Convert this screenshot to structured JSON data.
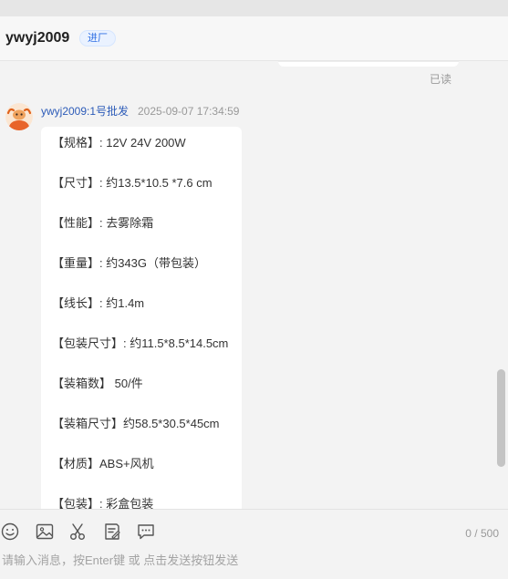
{
  "header": {
    "title": "ywyj2009",
    "badge": "进厂"
  },
  "chat": {
    "read_status": "已读",
    "message": {
      "sender": "ywyj2009:1号批发",
      "timestamp": "2025-09-07 17:34:59",
      "lines": [
        "【规格】: 12V 24V 200W",
        "【尺寸】: 约13.5*10.5 *7.6 cm",
        "【性能】: 去雾除霜",
        "【重量】: 约343G（带包装）",
        "【线长】: 约1.4m",
        "【包装尺寸】: 约11.5*8.5*14.5cm",
        "【装箱数】 50/件",
        "【装箱尺寸】约58.5*30.5*45cm",
        "【材质】ABS+风机",
        "【包装】: 彩盒包装"
      ]
    }
  },
  "input": {
    "placeholder": "请输入消息，按Enter键 或 点击发送按钮发送",
    "value": "",
    "counter": "0 / 500",
    "tools": [
      "emoji-icon",
      "image-icon",
      "scissors-icon",
      "order-icon",
      "quick-reply-icon"
    ]
  },
  "colors": {
    "sender": "#2c5bb8",
    "badge_text": "#2f6fe4",
    "background": "#f3f3f3"
  }
}
